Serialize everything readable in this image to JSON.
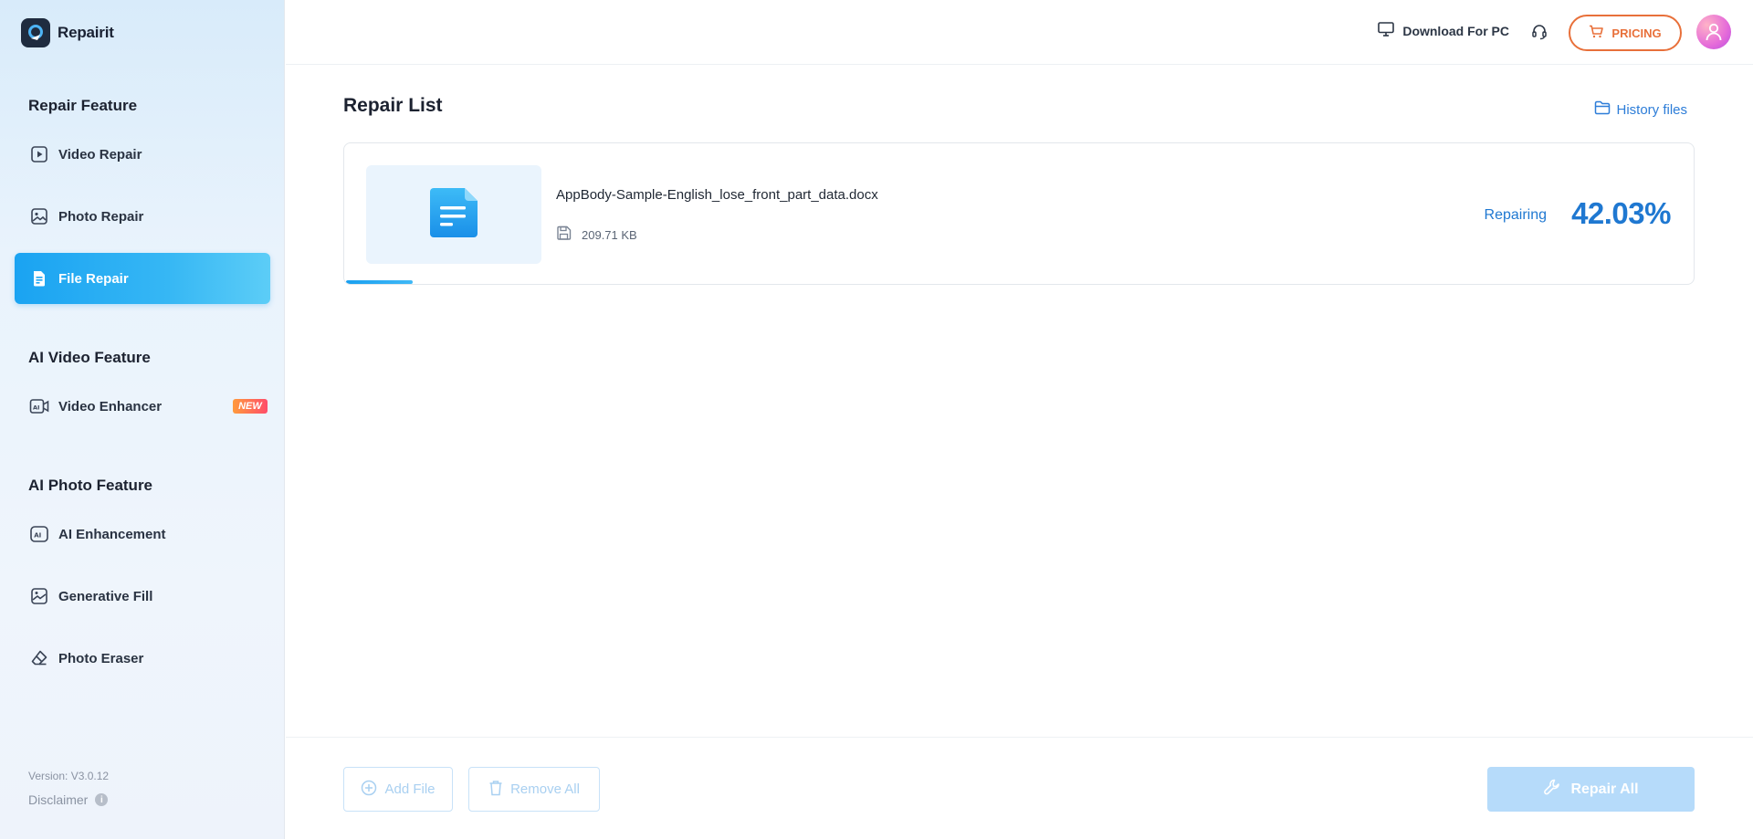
{
  "app": {
    "name": "Repairit",
    "version": "Version: V3.0.12",
    "disclaimer": "Disclaimer"
  },
  "sidebar": {
    "sections": [
      {
        "title": "Repair Feature"
      },
      {
        "title": "AI Video Feature"
      },
      {
        "title": "AI Photo Feature"
      }
    ],
    "items": [
      {
        "label": "Video Repair",
        "icon": "play-icon",
        "active": false
      },
      {
        "label": "Photo Repair",
        "icon": "photo-icon",
        "active": false
      },
      {
        "label": "File Repair",
        "icon": "document-icon",
        "active": true
      },
      {
        "label": "Video Enhancer",
        "icon": "ai-video-icon",
        "badge": "NEW"
      },
      {
        "label": "AI Enhancement",
        "icon": "ai-photo-icon"
      },
      {
        "label": "Generative Fill",
        "icon": "fill-icon"
      },
      {
        "label": "Photo Eraser",
        "icon": "eraser-icon"
      }
    ]
  },
  "header": {
    "download_label": "Download For PC",
    "pricing_label": "PRICING"
  },
  "main": {
    "title": "Repair List",
    "history_label": "History files",
    "file": {
      "name": "AppBody-Sample-English_lose_front_part_data.docx",
      "size": "209.71 KB",
      "status": "Repairing",
      "percent_text": "42.03%",
      "progress_fraction": 0.0495
    }
  },
  "footer": {
    "add_file": "Add File",
    "remove_all": "Remove All",
    "repair_all": "Repair All"
  },
  "colors": {
    "accent": "#1f78d1",
    "active_nav": "#1aa3f2",
    "pricing": "#e8703a",
    "disabled_primary": "#b6dbfa"
  }
}
